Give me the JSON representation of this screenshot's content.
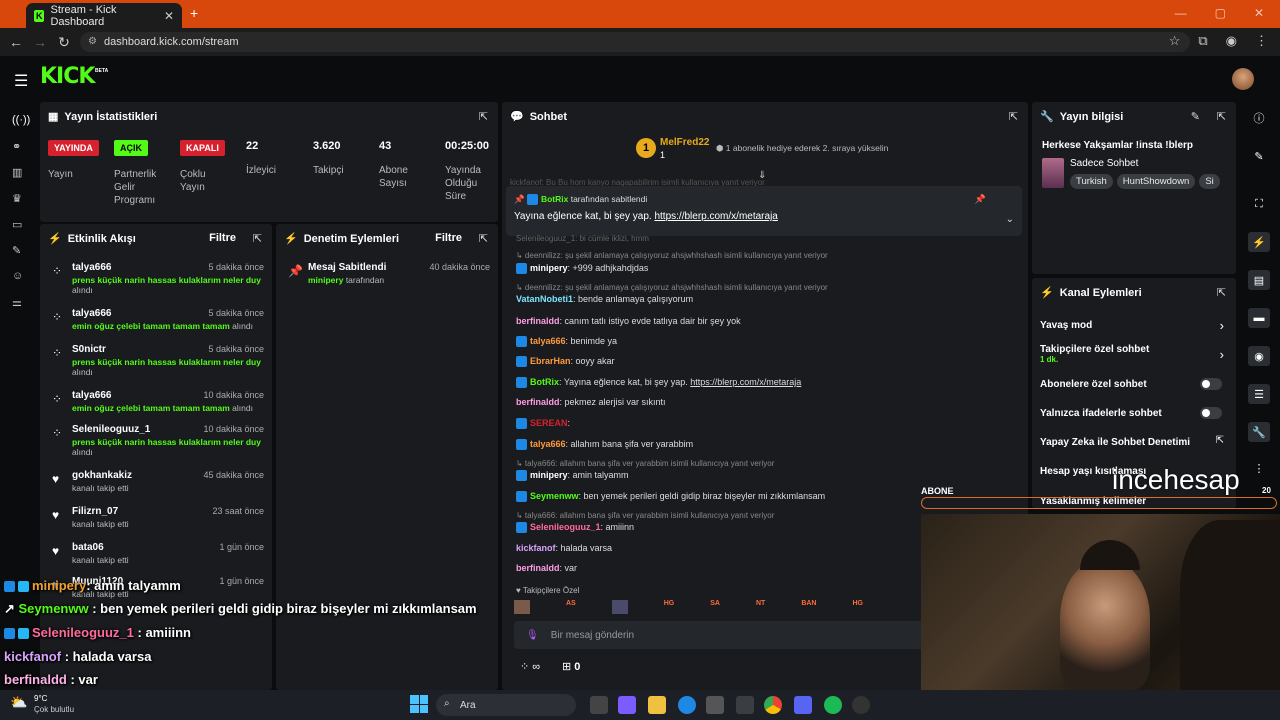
{
  "browser": {
    "tab_title": "Stream - Kick Dashboard",
    "url": "dashboard.kick.com/stream",
    "new_tab": "+",
    "tab_close": "✕",
    "win_min": "—",
    "win_max": "▢",
    "win_close": "✕"
  },
  "app": {
    "logo": "KICK",
    "beta": "BETA"
  },
  "stats": {
    "title": "Yayın İstatistikleri",
    "items": [
      {
        "badge": "YAYINDA",
        "badge_color": "#d6212f",
        "label": "Yayın"
      },
      {
        "badge": "AÇIK",
        "badge_color": "#53fc18",
        "label": "Partnerlik Gelir Programı"
      },
      {
        "badge": "KAPALI",
        "badge_color": "#d6212f",
        "label": "Çoklu Yayın"
      },
      {
        "value": "22",
        "label": "İzleyici"
      },
      {
        "value": "3.620",
        "label": "Takipçi"
      },
      {
        "value": "43",
        "label": "Abone Sayısı"
      },
      {
        "value": "00:25:00",
        "label": "Yayında Olduğu Süre"
      }
    ]
  },
  "activity": {
    "title": "Etkinlik Akışı",
    "filter": "Filtre",
    "items": [
      {
        "user": "talya666",
        "time": "5 dakika önce",
        "gift": "prens küçük narin hassas kulaklarım neler duy",
        "suffix": "alındı"
      },
      {
        "user": "talya666",
        "time": "5 dakika önce",
        "gift": "emin oğuz çelebi tamam tamam tamam",
        "suffix": "alındı"
      },
      {
        "user": "S0nictr",
        "time": "5 dakika önce",
        "gift": "prens küçük narin hassas kulaklarım neler duy",
        "suffix": "alındı"
      },
      {
        "user": "talya666",
        "time": "10 dakika önce",
        "gift": "emin oğuz çelebi tamam tamam tamam",
        "suffix": "alındı"
      },
      {
        "user": "Selenileoguuz_1",
        "time": "10 dakika önce",
        "gift": "prens küçük narin hassas kulaklarım neler duy",
        "suffix": "alındı"
      },
      {
        "user": "gokhankakiz",
        "time": "45 dakika önce",
        "follow": "kanalı takip etti"
      },
      {
        "user": "Filizrn_07",
        "time": "23 saat önce",
        "follow": "kanalı takip etti"
      },
      {
        "user": "bata06",
        "time": "1 gün önce",
        "follow": "kanalı takip etti"
      },
      {
        "user": "Muuni1120",
        "time": "1 gün önce",
        "follow": "kanalı takip etti"
      }
    ]
  },
  "moderation": {
    "title": "Denetim Eylemleri",
    "filter": "Filtre",
    "item": {
      "title": "Mesaj Sabitlendi",
      "time": "40 dakika önce",
      "user": "minipery",
      "suffix": "tarafından"
    }
  },
  "chat": {
    "title": "Sohbet",
    "top_gifter": {
      "rank": "1",
      "name": "MelFred22",
      "count": "1",
      "note": "1 abonelik hediye ederek 2. sıraya yükselin"
    },
    "pinned": {
      "by": "BotRix",
      "by_suffix": "tarafından sabitlendi",
      "text": "Yayına eğlence kat, bi şey yap.",
      "link": "https://blerp.com/x/metaraja"
    },
    "faded_top": "kickfanof: Bu Bu hom kanyo nagapabilirim isimli kullanıcıya yanıt veriyor",
    "partial_line": "Selenileoguuz_1: bi cümle iklizi, hmm",
    "messages": [
      {
        "reply": "deennilizz: şu şekil anlamaya çalışıyoruz ahsjwhhshash isimli kullanıcıya yanıt veriyor"
      },
      {
        "user": "minipery",
        "color": "#ffffff",
        "text": "+999 adhjkahdjdas",
        "badges": true
      },
      {
        "reply": "deennilizz: şu şekil anlamaya çalışıyoruz ahsjwhhshash isimli kullanıcıya yanıt veriyor"
      },
      {
        "user": "VatanNobeti1",
        "color": "#7be3ff",
        "text": "bende anlamaya çalışıyorum"
      },
      {
        "user": "berfinaldd",
        "color": "#ff9de5",
        "text": "canım tatlı istiyo evde tatlıya dair bir şey yok"
      },
      {
        "user": "talya666",
        "color": "#ff9a3c",
        "text": "benimde ya"
      },
      {
        "user": "EbrarHan",
        "color": "#ff9a3c",
        "text": "ooyy akar"
      },
      {
        "user": "BotRix",
        "color": "#53fc18",
        "text": "Yayına eğlence kat, bi şey yap.",
        "link": "https://blerp.com/x/metaraja"
      },
      {
        "user": "berfinaldd",
        "color": "#ff9de5",
        "text": "pekmez alerjisi var sıkıntı"
      },
      {
        "user": "SEREAN",
        "color": "#d6212f",
        "text": ""
      },
      {
        "user": "talya666",
        "color": "#ff9a3c",
        "text": "allahım bana şifa ver yarabbim"
      },
      {
        "reply": "talya666: allahım bana şifa ver yarabbim isimli kullanıcıya yanıt veriyor"
      },
      {
        "user": "minipery",
        "color": "#ffffff",
        "text": "amin talyamm"
      },
      {
        "user": "Seymenww",
        "color": "#53fc18",
        "text": "ben yemek perileri geldi gidip biraz bişeyler mi zıkkımlansam"
      },
      {
        "reply": "talya666: allahım bana şifa ver yarabbim isimli kullanıcıya yanıt veriyor"
      },
      {
        "user": "Selenileoguuz_1",
        "color": "#ff6b9a",
        "text": "amiiinn"
      },
      {
        "user": "kickfanof",
        "color": "#d9a3ff",
        "text": "halada varsa"
      },
      {
        "user": "berfinaldd",
        "color": "#ff9de5",
        "text": "var"
      }
    ],
    "followers_only": "Takipçilere Özel",
    "emotes": [
      "AS",
      "HG",
      "SA",
      "NT",
      "BAN",
      "HG"
    ],
    "input_placeholder": "Bir mesaj gönderin",
    "infinity": "∞",
    "points": "0"
  },
  "stream_info": {
    "title": "Yayın bilgisi",
    "stream_title": "Herkese Yakşamlar !insta !blerp",
    "category": "Sadece Sohbet",
    "tags": [
      "Turkish",
      "HuntShowdown",
      "Si"
    ]
  },
  "channel_actions": {
    "title": "Kanal Eylemleri",
    "slow_mode": "Yavaş mod",
    "followers_chat": "Takipçilere özel sohbet",
    "followers_sub": "1 dk.",
    "subs_chat": "Abonelere özel sohbet",
    "emotes_chat": "Yalnızca ifadelerle sohbet",
    "ai_mod": "Yapay Zeka ile Sohbet Denetimi",
    "age_limit": "Hesap yaşı kısıtlaması",
    "banned_words": "Yasaklanmış kelimeler"
  },
  "overlay": {
    "abone": "ABONE",
    "watermark": "incehesap",
    "sub_count": "20",
    "lines": [
      {
        "user": "minipery",
        "color": "#f0a030",
        "text": ": amin talyamm"
      },
      {
        "user": "Seymenww",
        "color": "#53fc18",
        "text": ": ben yemek perileri geldi gidip biraz bişeyler mi zıkkımlansam"
      },
      {
        "user": "Selenileoguuz_1",
        "color": "#ff6b9a",
        "text": ": amiiinn"
      },
      {
        "user": "kickfanof",
        "color": "#d9a3ff",
        "text": ": halada varsa"
      },
      {
        "user": "berfinaldd",
        "color": "#ffb3e6",
        "text": ": var"
      }
    ]
  },
  "taskbar": {
    "temp": "9°C",
    "weather": "Çok bulutlu",
    "search": "Ara"
  }
}
